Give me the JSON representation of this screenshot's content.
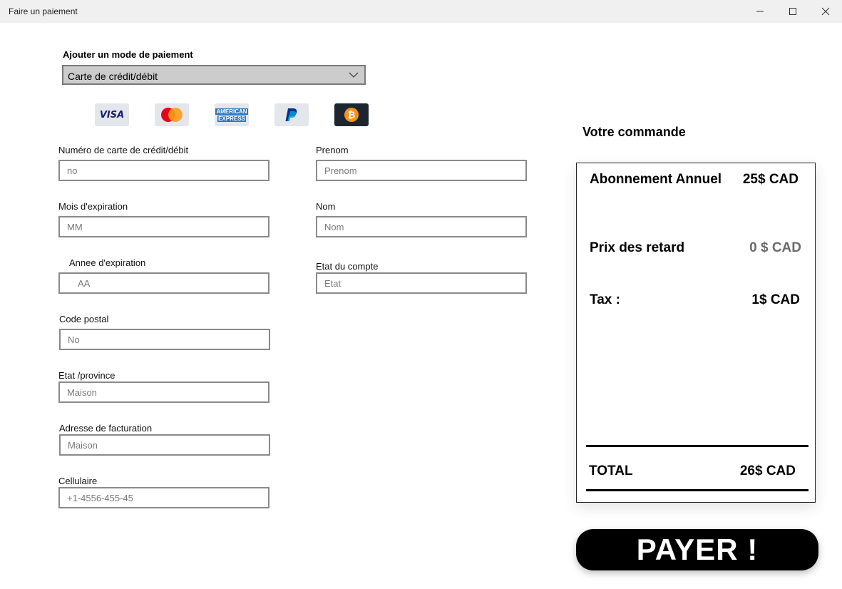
{
  "window": {
    "title": "Faire un paiement"
  },
  "payment": {
    "section_label": "Ajouter un mode de paiement",
    "method_selected": "Carte de crédit/débit",
    "icons": [
      "visa-icon",
      "mastercard-icon",
      "amex-icon",
      "paypal-icon",
      "bitcoin-icon"
    ],
    "visa_text": "VISA",
    "amex_text_1": "AMERICAN",
    "amex_text_2": "EXPRESS"
  },
  "form": {
    "card_number": {
      "label": "Numéro de carte de crédit/débit",
      "value": "no"
    },
    "expiry_month": {
      "label": "Mois d'expiration",
      "value": "MM"
    },
    "expiry_year": {
      "label": "Annee d'expiration",
      "value": "AA"
    },
    "postal_code": {
      "label": "Code postal",
      "value": "No"
    },
    "province": {
      "label": "Etat /province",
      "value": "Maison"
    },
    "billing_address": {
      "label": "Adresse de facturation",
      "value": "Maison"
    },
    "phone": {
      "label": "Cellulaire",
      "value": "+1-4556-455-45"
    },
    "first_name": {
      "label": "Prenom",
      "value": "Prenom"
    },
    "last_name": {
      "label": "Nom",
      "value": "Nom"
    },
    "account_state": {
      "label": "Etat du compte",
      "value": "Etat"
    }
  },
  "order": {
    "title": "Votre commande",
    "subscription_label": "Abonnement Annuel",
    "subscription_price": "25$ CAD",
    "late_fee_label": "Prix des retard",
    "late_fee_price": "0 $ CAD",
    "tax_label": "Tax :",
    "tax_price": "1$ CAD",
    "total_label": "TOTAL",
    "total_price": "26$ CAD"
  },
  "pay_button": {
    "label": "PAYER !"
  },
  "colors": {
    "button_bg": "#000000",
    "dropdown_bg": "#cccccc",
    "late_fee_text": "#6b6b6b"
  }
}
